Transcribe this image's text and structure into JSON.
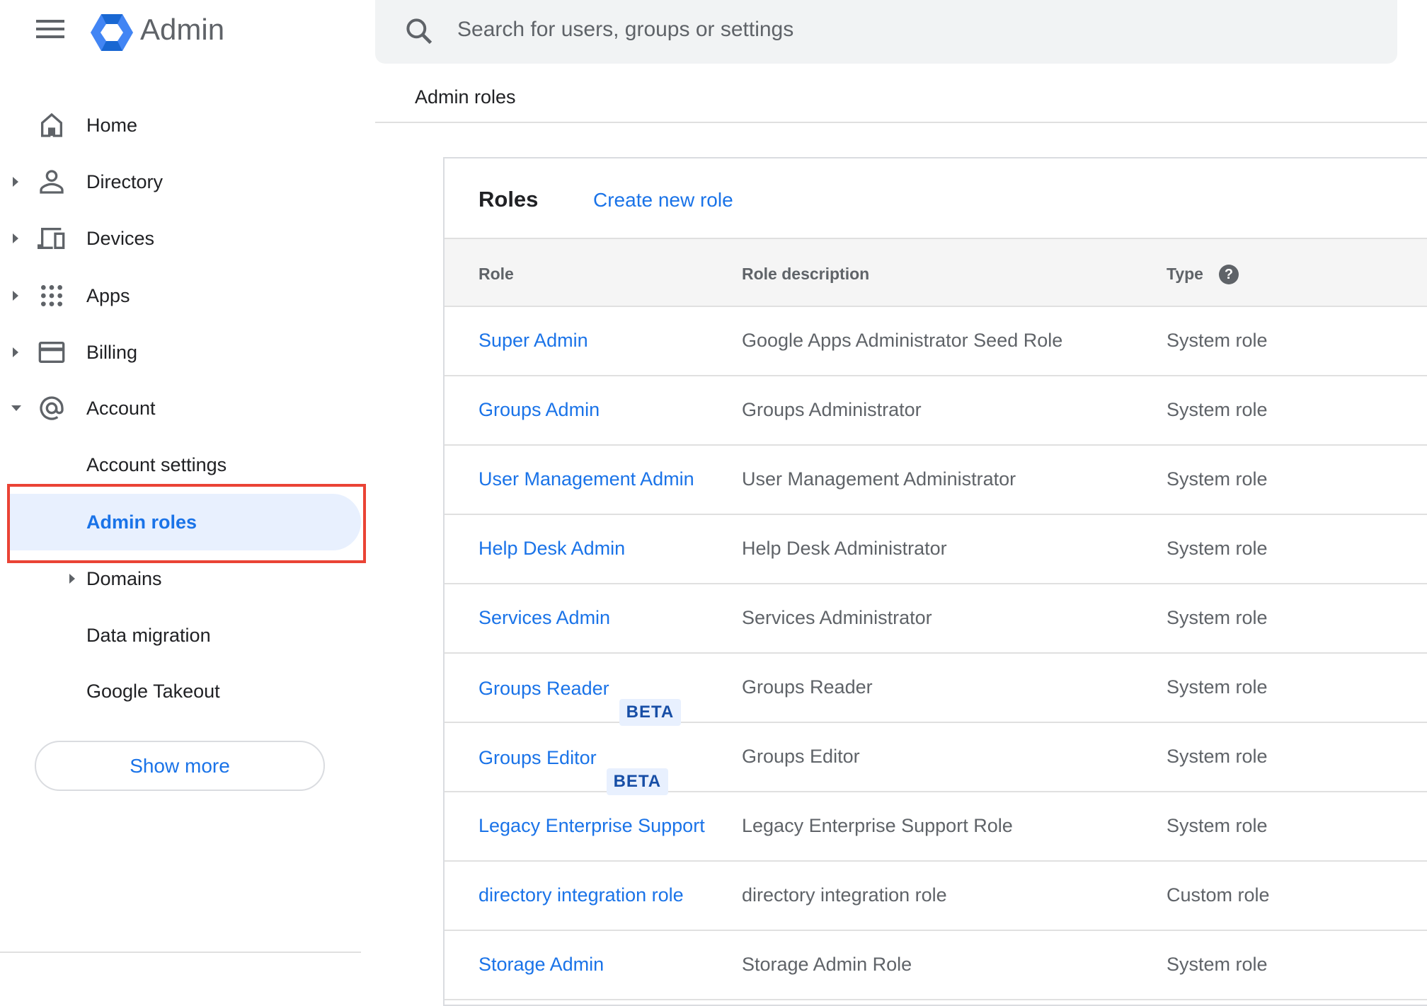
{
  "app": {
    "title": "Admin",
    "brand_color": "#1a73e8"
  },
  "search": {
    "placeholder": "Search for users, groups or settings"
  },
  "breadcrumb": "Admin roles",
  "sidebar": {
    "items": [
      {
        "label": "Home",
        "icon": "home-icon"
      },
      {
        "label": "Directory",
        "icon": "person-icon",
        "expandable": true
      },
      {
        "label": "Devices",
        "icon": "devices-icon",
        "expandable": true
      },
      {
        "label": "Apps",
        "icon": "apps-grid-icon",
        "expandable": true
      },
      {
        "label": "Billing",
        "icon": "credit-card-icon",
        "expandable": true
      },
      {
        "label": "Account",
        "icon": "at-sign-icon",
        "expanded": true
      }
    ],
    "subitems": [
      {
        "label": "Account settings"
      },
      {
        "label": "Admin roles",
        "active": true
      },
      {
        "label": "Domains",
        "expandable": true
      },
      {
        "label": "Data migration"
      },
      {
        "label": "Google Takeout"
      }
    ],
    "show_more": "Show more"
  },
  "roles": {
    "title": "Roles",
    "create_label": "Create new role",
    "columns": [
      "Role",
      "Role description",
      "Type"
    ],
    "rows": [
      {
        "role": "Super Admin",
        "description": "Google Apps Administrator Seed Role",
        "type": "System role"
      },
      {
        "role": "Groups Admin",
        "description": "Groups Administrator",
        "type": "System role"
      },
      {
        "role": "User Management Admin",
        "description": "User Management Administrator",
        "type": "System role"
      },
      {
        "role": "Help Desk Admin",
        "description": "Help Desk Administrator",
        "type": "System role"
      },
      {
        "role": "Services Admin",
        "description": "Services Administrator",
        "type": "System role"
      },
      {
        "role": "Groups Reader",
        "badge": "BETA",
        "description": "Groups Reader",
        "type": "System role"
      },
      {
        "role": "Groups Editor",
        "badge": "BETA",
        "description": "Groups Editor",
        "type": "System role"
      },
      {
        "role": "Legacy Enterprise Support",
        "description": "Legacy Enterprise Support Role",
        "type": "System role"
      },
      {
        "role": "directory integration role",
        "description": "directory integration role",
        "type": "Custom role"
      },
      {
        "role": "Storage Admin",
        "description": "Storage Admin Role",
        "type": "System role"
      }
    ]
  }
}
